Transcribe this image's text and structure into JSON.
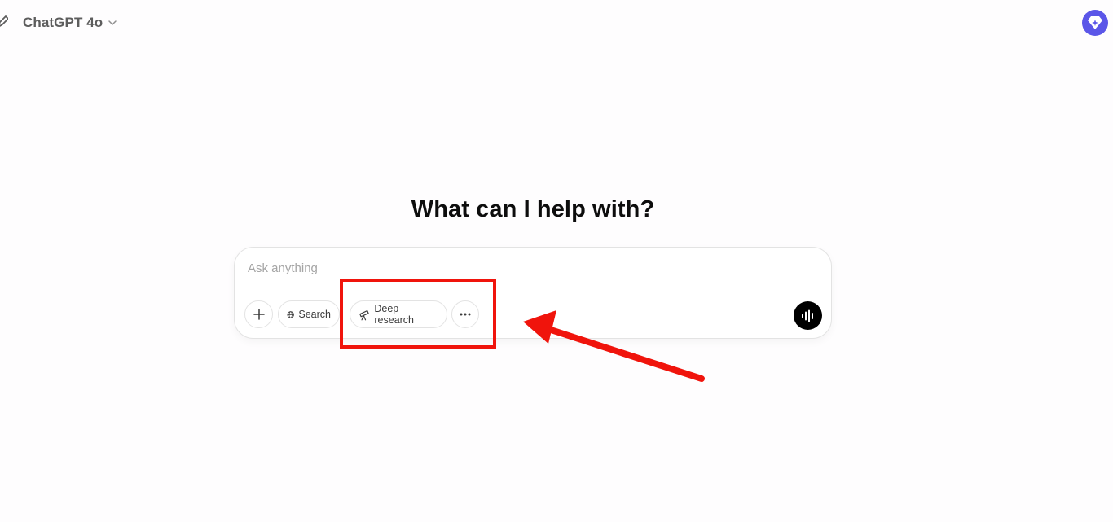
{
  "header": {
    "model_name": "ChatGPT 4o",
    "new_chat_icon": "edit-icon",
    "model_chevron_icon": "chevron-down-icon",
    "upgrade_icon": "diamond-sparkle-icon"
  },
  "main": {
    "heading": "What can I help with?"
  },
  "composer": {
    "placeholder": "Ask anything",
    "value": "",
    "tools": [
      {
        "label": "",
        "icon": "plus-icon"
      },
      {
        "label": "Search",
        "icon": "globe-icon"
      },
      {
        "label": "Deep research",
        "icon": "telescope-icon"
      },
      {
        "label": "",
        "icon": "ellipsis-icon"
      }
    ],
    "voice_icon": "voice-waveform-icon"
  },
  "annotations": {
    "highlight_color": "#f0140c",
    "arrow_color": "#f0140c"
  },
  "colors": {
    "accent": "#5b56e8",
    "background": "#fefdfe"
  }
}
